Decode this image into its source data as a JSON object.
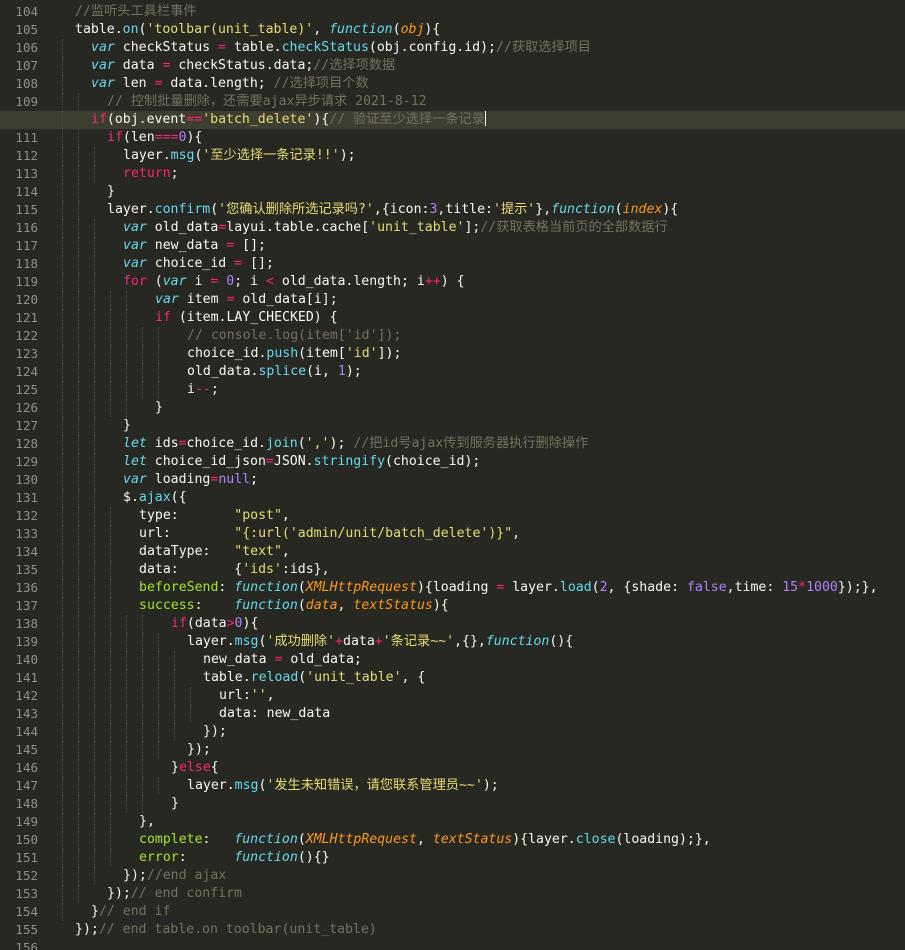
{
  "editor": {
    "theme": {
      "background": "#272822",
      "current_line": "#3e3d32",
      "gutter_text": "#8f908a",
      "comment": "#75715e",
      "string": "#e6db74",
      "keyword": "#f92672",
      "function": "#66d9ef",
      "parameter": "#fd971f",
      "number": "#ae81ff"
    },
    "first_line_number": 104,
    "current_line_number": 110,
    "cursor_after_line_number": 110,
    "lines": [
      {
        "n": "104",
        "ind": 1,
        "t": [
          [
            "c",
            "//监听头工具栏事件"
          ]
        ]
      },
      {
        "n": "105",
        "ind": 1,
        "t": [
          [
            "p",
            "table."
          ],
          [
            "f",
            "on"
          ],
          [
            "p",
            "("
          ],
          [
            "s",
            "'toolbar(unit_table)'"
          ],
          [
            "p",
            ", "
          ],
          [
            "k",
            "function"
          ],
          [
            "p",
            "("
          ],
          [
            "a",
            "obj"
          ],
          [
            "p",
            "){"
          ]
        ]
      },
      {
        "n": "106",
        "ind": 2,
        "t": [
          [
            "k",
            "var"
          ],
          [
            "p",
            " checkStatus "
          ],
          [
            "o",
            "="
          ],
          [
            "p",
            " table."
          ],
          [
            "f",
            "checkStatus"
          ],
          [
            "p",
            "(obj.config.id);"
          ],
          [
            "c",
            "//获取选择项目"
          ]
        ]
      },
      {
        "n": "107",
        "ind": 2,
        "t": [
          [
            "k",
            "var"
          ],
          [
            "p",
            " data "
          ],
          [
            "o",
            "="
          ],
          [
            "p",
            " checkStatus.data;"
          ],
          [
            "c",
            "//选择项数据"
          ]
        ]
      },
      {
        "n": "108",
        "ind": 2,
        "t": [
          [
            "k",
            "var"
          ],
          [
            "p",
            " len "
          ],
          [
            "o",
            "="
          ],
          [
            "p",
            " data.length; "
          ],
          [
            "c",
            "//选择项目个数"
          ]
        ]
      },
      {
        "n": "109",
        "ind": 3,
        "t": [
          [
            "c",
            "// 控制批量删除，还需要ajax异步请求 2021-8-12"
          ]
        ]
      },
      {
        "n": "110",
        "ind": 2,
        "t": [
          [
            "r",
            "if"
          ],
          [
            "p",
            "(obj.event"
          ],
          [
            "o",
            "=="
          ],
          [
            "s",
            "'batch_delete'"
          ],
          [
            "p",
            "){"
          ],
          [
            "c",
            "// 验证至少选择一条记录"
          ]
        ]
      },
      {
        "n": "111",
        "ind": 3,
        "t": [
          [
            "r",
            "if"
          ],
          [
            "p",
            "(len"
          ],
          [
            "o",
            "==="
          ],
          [
            "n",
            "0"
          ],
          [
            "p",
            "){"
          ]
        ]
      },
      {
        "n": "112",
        "ind": 4,
        "t": [
          [
            "p",
            "layer."
          ],
          [
            "f",
            "msg"
          ],
          [
            "p",
            "("
          ],
          [
            "s",
            "'至少选择一条记录!!'"
          ],
          [
            "p",
            ");"
          ]
        ]
      },
      {
        "n": "113",
        "ind": 4,
        "t": [
          [
            "r",
            "return"
          ],
          [
            "p",
            ";"
          ]
        ]
      },
      {
        "n": "114",
        "ind": 3,
        "t": [
          [
            "p",
            "}"
          ]
        ]
      },
      {
        "n": "115",
        "ind": 3,
        "t": [
          [
            "p",
            "layer."
          ],
          [
            "f",
            "confirm"
          ],
          [
            "p",
            "("
          ],
          [
            "s",
            "'您确认删除所选记录吗?'"
          ],
          [
            "p",
            ",{icon:"
          ],
          [
            "n",
            "3"
          ],
          [
            "p",
            ",title:"
          ],
          [
            "s",
            "'提示'"
          ],
          [
            "p",
            "},"
          ],
          [
            "k",
            "function"
          ],
          [
            "p",
            "("
          ],
          [
            "a",
            "index"
          ],
          [
            "p",
            "){"
          ]
        ]
      },
      {
        "n": "116",
        "ind": 4,
        "t": [
          [
            "k",
            "var"
          ],
          [
            "p",
            " old_data"
          ],
          [
            "o",
            "="
          ],
          [
            "p",
            "layui.table.cache["
          ],
          [
            "s",
            "'unit_table'"
          ],
          [
            "p",
            "];"
          ],
          [
            "c",
            "//获取表格当前页的全部数据行"
          ]
        ]
      },
      {
        "n": "117",
        "ind": 4,
        "t": [
          [
            "k",
            "var"
          ],
          [
            "p",
            " new_data "
          ],
          [
            "o",
            "="
          ],
          [
            "p",
            " [];"
          ]
        ]
      },
      {
        "n": "118",
        "ind": 4,
        "t": [
          [
            "k",
            "var"
          ],
          [
            "p",
            " choice_id "
          ],
          [
            "o",
            "="
          ],
          [
            "p",
            " [];"
          ]
        ]
      },
      {
        "n": "119",
        "ind": 4,
        "t": [
          [
            "r",
            "for"
          ],
          [
            "p",
            " ("
          ],
          [
            "k",
            "var"
          ],
          [
            "p",
            " i "
          ],
          [
            "o",
            "="
          ],
          [
            "p",
            " "
          ],
          [
            "n",
            "0"
          ],
          [
            "p",
            "; i "
          ],
          [
            "o",
            "<"
          ],
          [
            "p",
            " old_data.length; i"
          ],
          [
            "o",
            "++"
          ],
          [
            "p",
            ") {"
          ]
        ]
      },
      {
        "n": "120",
        "ind": 6,
        "t": [
          [
            "k",
            "var"
          ],
          [
            "p",
            " item "
          ],
          [
            "o",
            "="
          ],
          [
            "p",
            " old_data[i];"
          ]
        ]
      },
      {
        "n": "121",
        "ind": 6,
        "t": [
          [
            "r",
            "if"
          ],
          [
            "p",
            " (item.LAY_CHECKED) {"
          ]
        ]
      },
      {
        "n": "122",
        "ind": 8,
        "t": [
          [
            "c",
            "// console.log(item['id']);"
          ]
        ]
      },
      {
        "n": "123",
        "ind": 8,
        "t": [
          [
            "p",
            "choice_id."
          ],
          [
            "f",
            "push"
          ],
          [
            "p",
            "(item["
          ],
          [
            "s",
            "'id'"
          ],
          [
            "p",
            "]);"
          ]
        ]
      },
      {
        "n": "124",
        "ind": 8,
        "t": [
          [
            "p",
            "old_data."
          ],
          [
            "f",
            "splice"
          ],
          [
            "p",
            "(i, "
          ],
          [
            "n",
            "1"
          ],
          [
            "p",
            ");"
          ]
        ]
      },
      {
        "n": "125",
        "ind": 8,
        "t": [
          [
            "p",
            "i"
          ],
          [
            "o",
            "--"
          ],
          [
            "p",
            ";"
          ]
        ]
      },
      {
        "n": "126",
        "ind": 6,
        "t": [
          [
            "p",
            "}"
          ]
        ]
      },
      {
        "n": "127",
        "ind": 4,
        "t": [
          [
            "p",
            "}"
          ]
        ]
      },
      {
        "n": "128",
        "ind": 4,
        "t": [
          [
            "k",
            "let"
          ],
          [
            "p",
            " ids"
          ],
          [
            "o",
            "="
          ],
          [
            "p",
            "choice_id."
          ],
          [
            "f",
            "join"
          ],
          [
            "p",
            "("
          ],
          [
            "s",
            "','"
          ],
          [
            "p",
            "); "
          ],
          [
            "c",
            "//把id号ajax传到服务器执行删除操作"
          ]
        ]
      },
      {
        "n": "129",
        "ind": 4,
        "t": [
          [
            "k",
            "let"
          ],
          [
            "p",
            " choice_id_json"
          ],
          [
            "o",
            "="
          ],
          [
            "p",
            "JSON."
          ],
          [
            "f",
            "stringify"
          ],
          [
            "p",
            "(choice_id);"
          ]
        ]
      },
      {
        "n": "130",
        "ind": 4,
        "t": [
          [
            "k",
            "var"
          ],
          [
            "p",
            " loading"
          ],
          [
            "o",
            "="
          ],
          [
            "i",
            "null"
          ],
          [
            "p",
            ";"
          ]
        ]
      },
      {
        "n": "131",
        "ind": 4,
        "t": [
          [
            "p",
            "$."
          ],
          [
            "f",
            "ajax"
          ],
          [
            "p",
            "({"
          ]
        ]
      },
      {
        "n": "132",
        "ind": 5,
        "t": [
          [
            "p",
            "type:       "
          ],
          [
            "s",
            "\"post\""
          ],
          [
            "p",
            ","
          ]
        ]
      },
      {
        "n": "133",
        "ind": 5,
        "t": [
          [
            "p",
            "url:        "
          ],
          [
            "s",
            "\"{:url('admin/unit/batch_delete')}\""
          ],
          [
            "p",
            ","
          ]
        ]
      },
      {
        "n": "134",
        "ind": 5,
        "t": [
          [
            "p",
            "dataType:   "
          ],
          [
            "s",
            "\"text\""
          ],
          [
            "p",
            ","
          ]
        ]
      },
      {
        "n": "135",
        "ind": 5,
        "t": [
          [
            "p",
            "data:       {"
          ],
          [
            "s",
            "'ids'"
          ],
          [
            "p",
            ":ids},"
          ]
        ]
      },
      {
        "n": "136",
        "ind": 5,
        "t": [
          [
            "g",
            "beforeSend"
          ],
          [
            "p",
            ": "
          ],
          [
            "k",
            "function"
          ],
          [
            "p",
            "("
          ],
          [
            "a",
            "XMLHttpRequest"
          ],
          [
            "p",
            "){loading "
          ],
          [
            "o",
            "="
          ],
          [
            "p",
            " layer."
          ],
          [
            "f",
            "load"
          ],
          [
            "p",
            "("
          ],
          [
            "n",
            "2"
          ],
          [
            "p",
            ", {shade: "
          ],
          [
            "i",
            "false"
          ],
          [
            "p",
            ",time: "
          ],
          [
            "n",
            "15"
          ],
          [
            "o",
            "*"
          ],
          [
            "n",
            "1000"
          ],
          [
            "p",
            "});},"
          ]
        ]
      },
      {
        "n": "137",
        "ind": 5,
        "t": [
          [
            "g",
            "success"
          ],
          [
            "p",
            ":    "
          ],
          [
            "k",
            "function"
          ],
          [
            "p",
            "("
          ],
          [
            "a",
            "data"
          ],
          [
            "p",
            ", "
          ],
          [
            "a",
            "textStatus"
          ],
          [
            "p",
            "){"
          ]
        ]
      },
      {
        "n": "138",
        "ind": 7,
        "t": [
          [
            "r",
            "if"
          ],
          [
            "p",
            "(data"
          ],
          [
            "o",
            ">"
          ],
          [
            "n",
            "0"
          ],
          [
            "p",
            "){"
          ]
        ]
      },
      {
        "n": "139",
        "ind": 8,
        "t": [
          [
            "p",
            "layer."
          ],
          [
            "f",
            "msg"
          ],
          [
            "p",
            "("
          ],
          [
            "s",
            "'成功删除'"
          ],
          [
            "o",
            "+"
          ],
          [
            "p",
            "data"
          ],
          [
            "o",
            "+"
          ],
          [
            "s",
            "'条记录~~'"
          ],
          [
            "p",
            ",{},"
          ],
          [
            "k",
            "function"
          ],
          [
            "p",
            "(){"
          ]
        ]
      },
      {
        "n": "140",
        "ind": 9,
        "t": [
          [
            "p",
            "new_data "
          ],
          [
            "o",
            "="
          ],
          [
            "p",
            " old_data;"
          ]
        ]
      },
      {
        "n": "141",
        "ind": 9,
        "t": [
          [
            "p",
            "table."
          ],
          [
            "f",
            "reload"
          ],
          [
            "p",
            "("
          ],
          [
            "s",
            "'unit_table'"
          ],
          [
            "p",
            ", {"
          ]
        ]
      },
      {
        "n": "142",
        "ind": 10,
        "t": [
          [
            "p",
            "url:"
          ],
          [
            "s",
            "''"
          ],
          [
            "p",
            ","
          ]
        ]
      },
      {
        "n": "143",
        "ind": 10,
        "t": [
          [
            "p",
            "data: new_data"
          ]
        ]
      },
      {
        "n": "144",
        "ind": 9,
        "t": [
          [
            "p",
            "});"
          ]
        ]
      },
      {
        "n": "145",
        "ind": 8,
        "t": [
          [
            "p",
            "});"
          ]
        ]
      },
      {
        "n": "146",
        "ind": 7,
        "t": [
          [
            "p",
            "}"
          ],
          [
            "r",
            "else"
          ],
          [
            "p",
            "{"
          ]
        ]
      },
      {
        "n": "147",
        "ind": 8,
        "t": [
          [
            "p",
            "layer."
          ],
          [
            "f",
            "msg"
          ],
          [
            "p",
            "("
          ],
          [
            "s",
            "'发生未知错误，请您联系管理员~~'"
          ],
          [
            "p",
            ");"
          ]
        ]
      },
      {
        "n": "148",
        "ind": 7,
        "t": [
          [
            "p",
            "}"
          ]
        ]
      },
      {
        "n": "149",
        "ind": 5,
        "t": [
          [
            "p",
            "},"
          ]
        ]
      },
      {
        "n": "150",
        "ind": 5,
        "t": [
          [
            "g",
            "complete"
          ],
          [
            "p",
            ":   "
          ],
          [
            "k",
            "function"
          ],
          [
            "p",
            "("
          ],
          [
            "a",
            "XMLHttpRequest"
          ],
          [
            "p",
            ", "
          ],
          [
            "a",
            "textStatus"
          ],
          [
            "p",
            "){layer."
          ],
          [
            "f",
            "close"
          ],
          [
            "p",
            "(loading);},"
          ]
        ]
      },
      {
        "n": "151",
        "ind": 5,
        "t": [
          [
            "g",
            "error"
          ],
          [
            "p",
            ":      "
          ],
          [
            "k",
            "function"
          ],
          [
            "p",
            "(){}"
          ]
        ]
      },
      {
        "n": "152",
        "ind": 4,
        "t": [
          [
            "p",
            "});"
          ],
          [
            "c",
            "//end ajax"
          ]
        ]
      },
      {
        "n": "153",
        "ind": 3,
        "t": [
          [
            "p",
            "});"
          ],
          [
            "c",
            "// end confirm"
          ]
        ]
      },
      {
        "n": "154",
        "ind": 2,
        "t": [
          [
            "p",
            "}"
          ],
          [
            "c",
            "// end if"
          ]
        ]
      },
      {
        "n": "155",
        "ind": 1,
        "t": [
          [
            "p",
            "});"
          ],
          [
            "c",
            "// end table.on toolbar(unit_table)"
          ]
        ]
      },
      {
        "n": "156",
        "ind": 0,
        "t": []
      }
    ]
  }
}
